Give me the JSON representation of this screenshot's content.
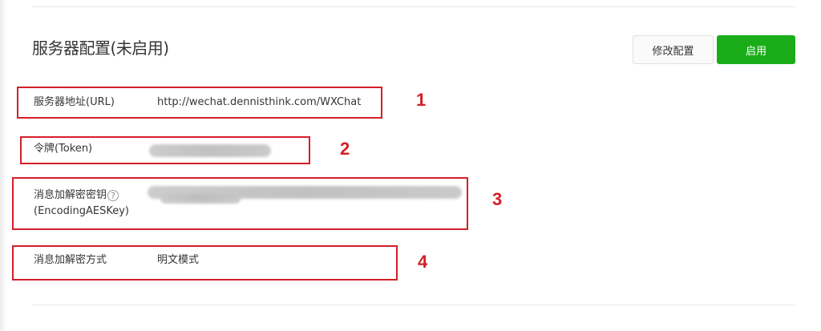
{
  "section": {
    "title": "服务器配置(未启用)",
    "buttons": {
      "modify_label": "修改配置",
      "enable_label": "启用"
    }
  },
  "config_rows": [
    {
      "label": "服务器地址(URL)",
      "value": "http://wechat.dennisthink.com/WXChat"
    },
    {
      "label": "令牌(Token)",
      "value": ""
    },
    {
      "label": "消息加解密密钥",
      "label_sub": "(EncodingAESKey)",
      "value": ""
    },
    {
      "label": "消息加解密方式",
      "value": "明文模式"
    }
  ],
  "annotations": [
    "1",
    "2",
    "3",
    "4"
  ],
  "help_icon_glyph": "?",
  "colors": {
    "primary_button": "#1aad19",
    "annotation": "#d32027",
    "divider": "#e4e8eb"
  },
  "icons": {
    "help": "question-circle-icon"
  }
}
